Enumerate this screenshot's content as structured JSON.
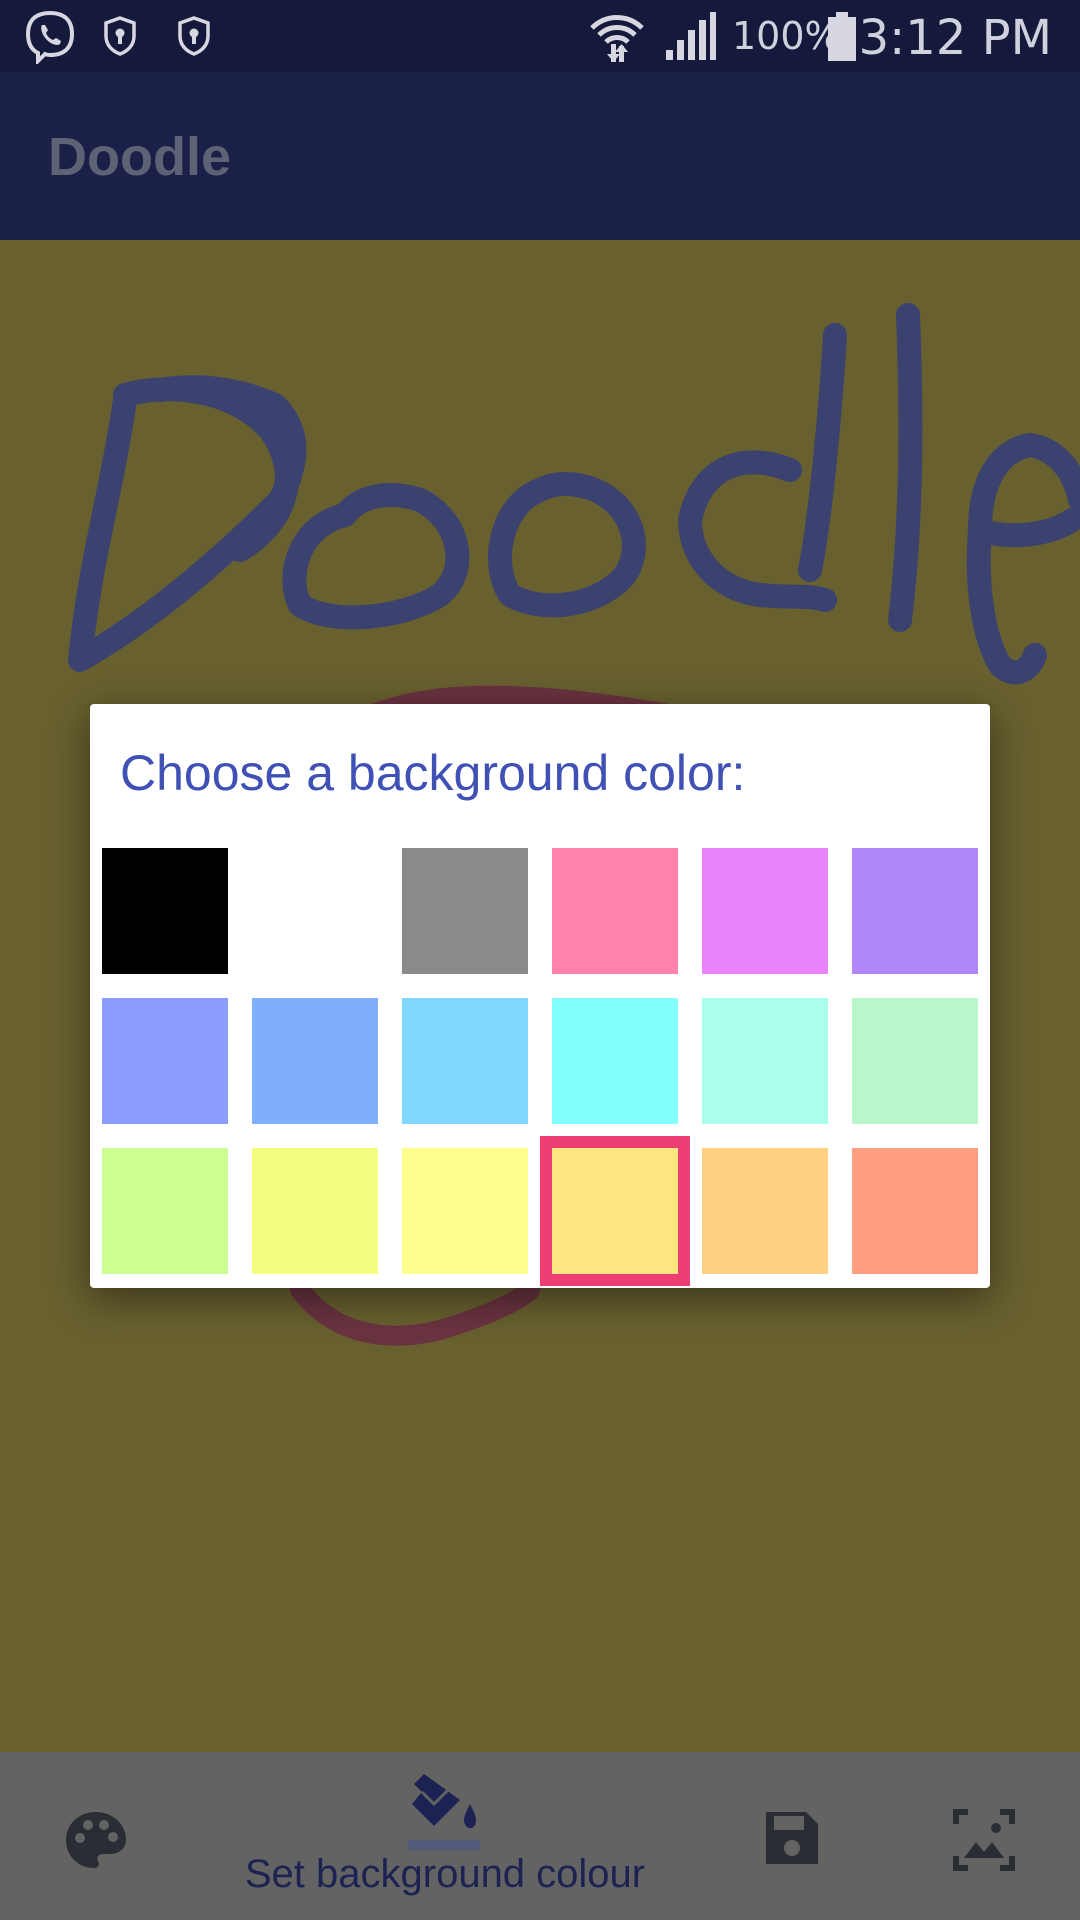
{
  "status_bar": {
    "battery": "100%",
    "time": "3:12 PM",
    "icons": [
      "viber-icon",
      "shield-icon",
      "shield-icon",
      "wifi-icon",
      "signal-icon",
      "battery-icon"
    ]
  },
  "app_bar": {
    "title": "Doodle"
  },
  "canvas": {
    "background_color": "#68602f",
    "stroke_color": "#3b4270",
    "second_stroke_color": "#6a3340"
  },
  "dialog": {
    "title": "Choose a background color:",
    "selected_index": 15,
    "colors": [
      "#000000",
      "#ffffff",
      "#8a8a8a",
      "#ff82ac",
      "#e983f9",
      "#b186f9",
      "#8c9dfe",
      "#80aefe",
      "#80d8fe",
      "#83ffff",
      "#a9ffeb",
      "#b9f6ca",
      "#ccff8f",
      "#f3fe81",
      "#fffe8d",
      "#ffe57f",
      "#ffd180",
      "#ff9e80"
    ]
  },
  "bottom_bar": {
    "active_label": "Set background colour",
    "buttons": [
      "palette-icon",
      "paint-bucket-icon",
      "save-icon",
      "image-icon"
    ]
  }
}
